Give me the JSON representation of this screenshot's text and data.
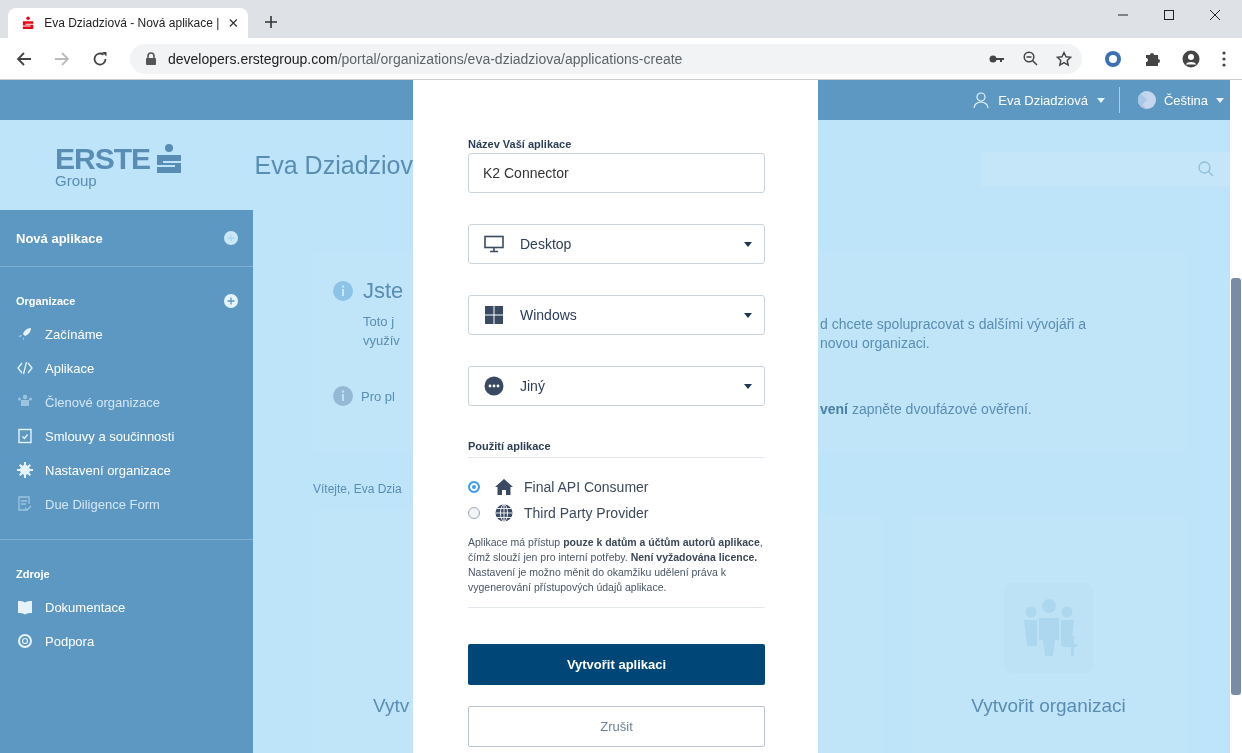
{
  "browser": {
    "tab_title": "Eva Dziadziová - Nová aplikace |",
    "url_host": "developers.erstegroup.com",
    "url_path": "/portal/organizations/eva-dziadziova/applications-create",
    "forward_disabled": true
  },
  "topbar": {
    "user": "Eva Dziadziová",
    "language": "Čeština"
  },
  "header": {
    "logo_word": "ERSTE",
    "logo_sub": "Group",
    "title": "Eva Dziadziov"
  },
  "sidebar": {
    "new_app": "Nová aplikace",
    "groups": [
      {
        "title": "Organizace",
        "add": true,
        "items": [
          {
            "label": "Začínáme",
            "disabled": false
          },
          {
            "label": "Aplikace",
            "disabled": false
          },
          {
            "label": "Členové organizace",
            "disabled": true
          },
          {
            "label": "Smlouvy a součinnosti",
            "disabled": false
          },
          {
            "label": "Nastavení organizace",
            "disabled": false
          },
          {
            "label": "Due Diligence Form",
            "disabled": true
          }
        ]
      },
      {
        "title": "Zdroje",
        "add": false,
        "items": [
          {
            "label": "Dokumentace",
            "disabled": false
          },
          {
            "label": "Podpora",
            "disabled": false
          }
        ]
      }
    ]
  },
  "info_card": {
    "heading": "Jste",
    "text_left": [
      "Toto j",
      "využív"
    ],
    "text_right": [
      "d chcete spolupracovat s dalšími vývojáři a",
      "novou organizaci."
    ],
    "note_left": "Pro pl",
    "note_right": "**vení** zapněte dvoufázové ověření."
  },
  "welcome": "Vítejte, Eva Dzia",
  "cards": [
    "Vytv",
    "Vytvořit organizaci"
  ],
  "modal": {
    "name_label": "Název Vaší aplikace",
    "name_value": "K2 Connector",
    "selects": [
      {
        "value": "Desktop"
      },
      {
        "value": "Windows"
      },
      {
        "value": "Jiný"
      }
    ],
    "usage_label": "Použití aplikace",
    "options": [
      {
        "label": "Final API Consumer",
        "selected": true
      },
      {
        "label": "Third Party Provider",
        "selected": false
      }
    ],
    "description": "Aplikace má přístup **pouze k datům a účtům autorů aplikace**, čímž slouží jen pro interní potřeby. **Není vyžadována licence.** Nastavení je možno měnit do okamžiku udělení práva k vygenerování přístupových údajů aplikace.",
    "create_button": "Vytvořit aplikaci",
    "cancel_button": "Zrušit"
  }
}
